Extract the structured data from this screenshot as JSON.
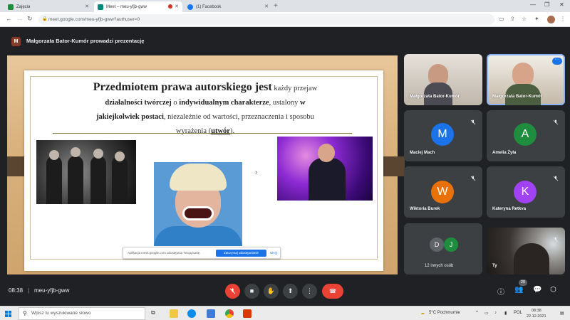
{
  "browser": {
    "tabs": [
      {
        "label": "Zajęcia",
        "favicon_color": "#1e8e3e"
      },
      {
        "label": "Meet – meu-yfjb-gww",
        "favicon_color": "#00897b",
        "active": true
      },
      {
        "label": "(1) Facebook",
        "favicon_color": "#1877f2"
      }
    ],
    "new_tab": "+",
    "address": "meet.google.com/meu-yfjb-gww?authuser=0"
  },
  "meet": {
    "presenter_initial": "M",
    "presenter_text": "Małgorzata Bator-Kumór prowadzi prezentację",
    "slide": {
      "line1_big": "Przedmiotem prawa autorskiego jest",
      "line1_rest": " każdy przejaw",
      "line2_bold_a": "działalności twórczej",
      "line2_mid": " o ",
      "line2_bold_b": "indywidualnym charakterze",
      "line2_rest": ", ustalony ",
      "line2_bold_c": "w",
      "line3_bold": "jakiejkolwiek postaci",
      "line3_rest": ", niezależnie od wartości, przeznaczenia i sposobu",
      "line4_a": "wyrażenia (",
      "line4_u": "utwór",
      "line4_b": ")."
    },
    "notification": {
      "text": "Aplikacja meet.google.com udostępnia Twoją kartę.",
      "stop_button": "Zatrzymaj udostępnianie",
      "hide_button": "Ukryj"
    },
    "participants": [
      {
        "name": "Małgorzata Bator-Kumór",
        "type": "video"
      },
      {
        "name": "Małgorzata Bator-Kumór",
        "type": "video"
      },
      {
        "name": "Maciej Mach",
        "initial": "M",
        "color": "#1a73e8"
      },
      {
        "name": "Amelia Żyła",
        "initial": "A",
        "color": "#1e8e3e"
      },
      {
        "name": "Wiktoria Burek",
        "initial": "W",
        "color": "#e8710a"
      },
      {
        "name": "Kateryna Retkva",
        "initial": "K",
        "color": "#a142f4"
      }
    ],
    "others": {
      "label": "12 innych osób",
      "initials": [
        "D",
        "J"
      ],
      "colors": [
        "#5f6368",
        "#1e8e3e"
      ]
    },
    "self_tile": {
      "name": "Ty"
    },
    "time": "08:38",
    "separator": "|",
    "meeting_code": "meu-yfjb-gww",
    "people_count": "20"
  },
  "taskbar": {
    "search_placeholder": "Wpisz tu wyszukiwane słowo",
    "weather": "5°C Pochmurnie",
    "language": "POL",
    "time": "08:38",
    "date": "22.12.2021"
  }
}
